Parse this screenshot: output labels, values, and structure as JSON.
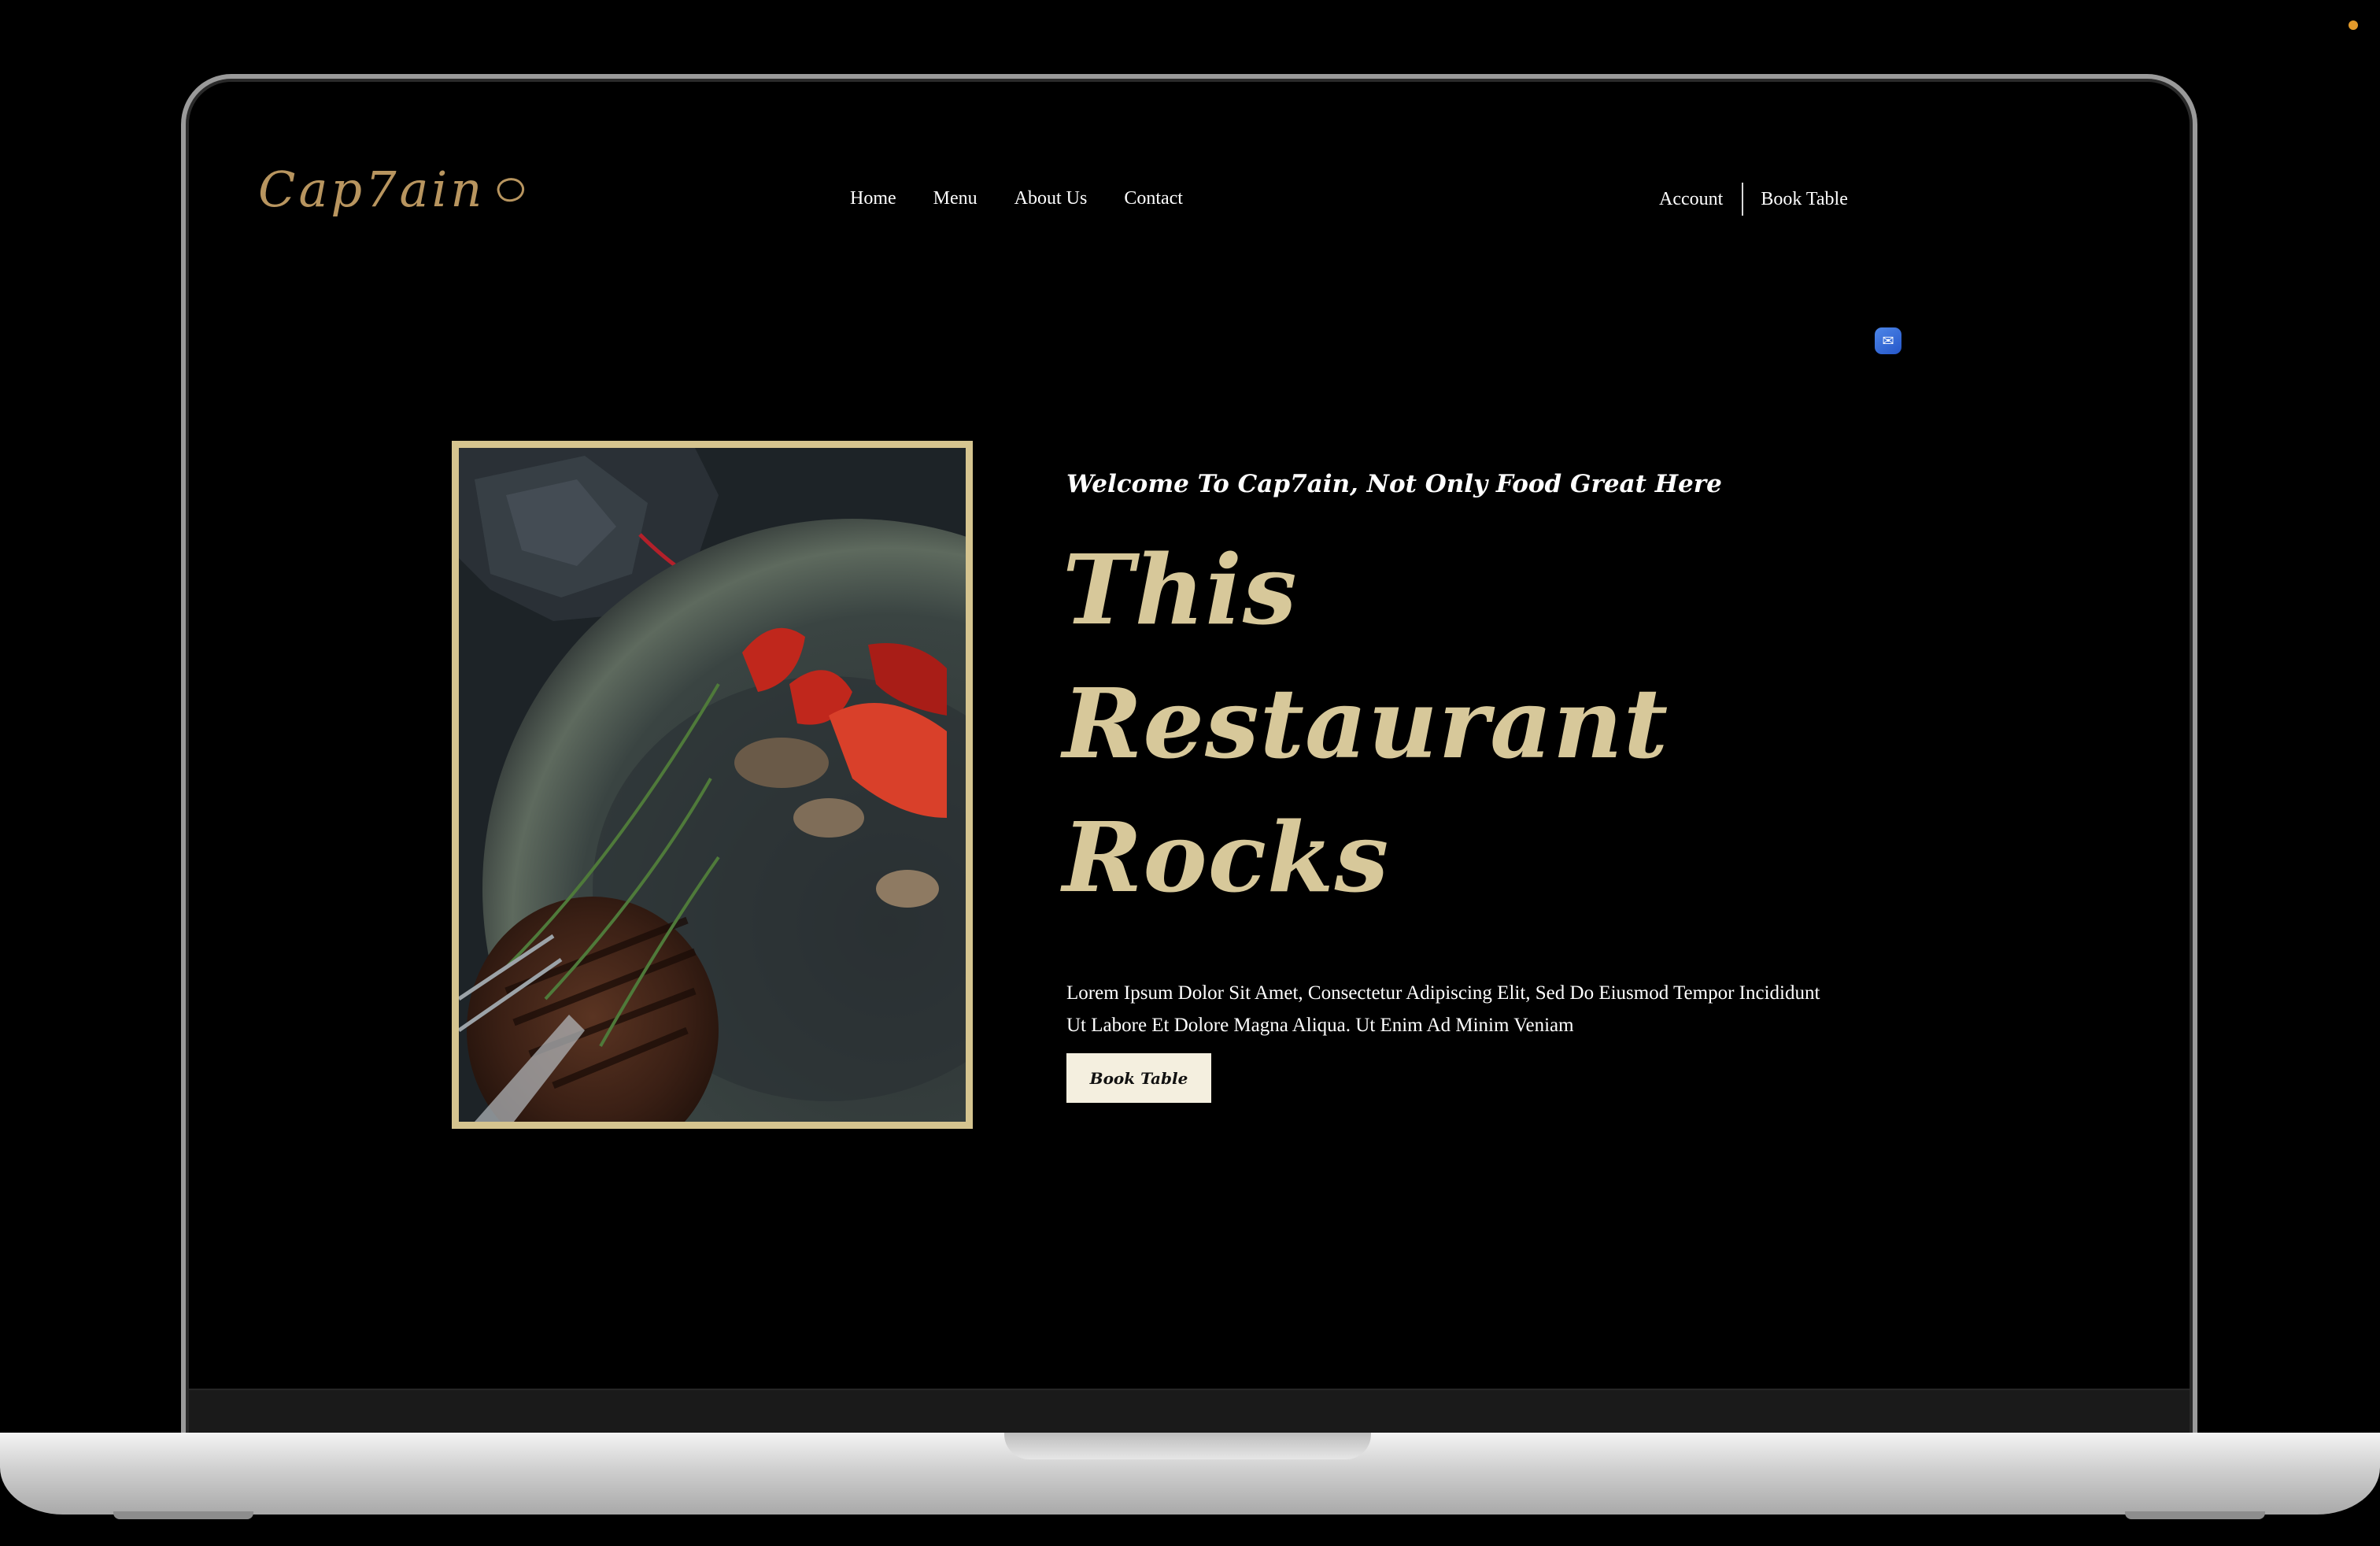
{
  "brand": {
    "logo_text": "Cap7ain"
  },
  "nav": {
    "items": [
      {
        "label": "Home"
      },
      {
        "label": "Menu"
      },
      {
        "label": "About Us"
      },
      {
        "label": "Contact"
      }
    ]
  },
  "header_actions": {
    "account_label": "Account",
    "book_table_label": "Book Table"
  },
  "hero": {
    "welcome_text": "Welcome To Cap7ain, Not Only Food Great Here",
    "headline_lines": [
      "This",
      "Restaurant",
      "Rocks"
    ],
    "description": "Lorem Ipsum Dolor Sit Amet, Consectetur Adipiscing Elit, Sed Do Eiusmod Tempor Incididunt Ut Labore Et Dolore Magna Aliqua. Ut Enim Ad Minim Veniam",
    "cta_label": "Book Table",
    "image_icon": "steak-plate-photo"
  },
  "widgets": {
    "chat_icon": "chat-bubble-icon"
  },
  "colors": {
    "background": "#000000",
    "accent_gold": "#d7c89a",
    "logo_gold": "#b8955f",
    "frame_gold": "#d5c48f",
    "button_bg": "#f4efdf",
    "status_dot": "#e39a2b",
    "chat_blue": "#3a6fdc"
  }
}
